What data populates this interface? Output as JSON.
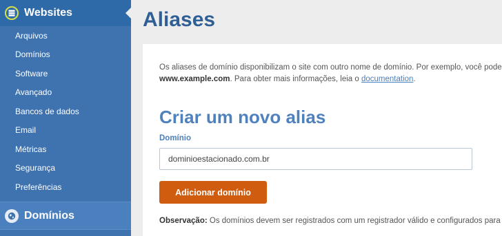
{
  "sidebar": {
    "header_title": "Websites",
    "items": [
      {
        "label": "Arquivos"
      },
      {
        "label": "Domínios"
      },
      {
        "label": "Software"
      },
      {
        "label": "Avançado"
      },
      {
        "label": "Bancos de dados"
      },
      {
        "label": "Email"
      },
      {
        "label": "Métricas"
      },
      {
        "label": "Segurança"
      },
      {
        "label": "Preferências"
      }
    ],
    "section_title": "Domínios"
  },
  "main": {
    "title": "Aliases",
    "description": {
      "text1": "Os aliases de domínio disponibilizam o site com outro nome de domínio. Por exemplo, você pode f",
      "bold": "www.example.com",
      "text2": ". Para obter mais informações, leia o ",
      "link": "documentation",
      "text3": "."
    },
    "subtitle": "Criar um novo alias",
    "field_label": "Domínio",
    "field_value": "dominioestacionado.com.br",
    "button_label": "Adicionar domínio",
    "note_label": "Observação:",
    "note_text": " Os domínios devem ser registrados com um registrador válido e configurados para a"
  },
  "colors": {
    "sidebar": "#3f73b0",
    "title": "#2f5f94",
    "accent_button": "#cf5c0f",
    "link": "#4a7fbd"
  }
}
